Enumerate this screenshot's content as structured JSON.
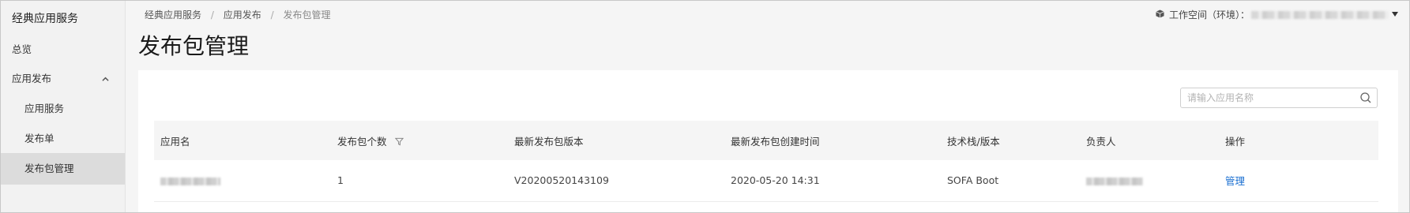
{
  "sidebar": {
    "title": "经典应用服务",
    "items": [
      {
        "label": "总览"
      },
      {
        "label": "应用发布",
        "expanded": true
      },
      {
        "label": "应用服务"
      },
      {
        "label": "发布单"
      },
      {
        "label": "发布包管理",
        "active": true
      }
    ]
  },
  "breadcrumb": [
    "经典应用服务",
    "应用发布",
    "发布包管理"
  ],
  "breadcrumb_sep": "/",
  "page": {
    "title": "发布包管理"
  },
  "workspace": {
    "label": "工作空间（环境）：",
    "icon": "cube-icon"
  },
  "search": {
    "placeholder": "请输入应用名称",
    "icon": "search-icon"
  },
  "table": {
    "columns": [
      "应用名",
      "发布包个数",
      "最新发布包版本",
      "最新发布包创建时间",
      "技术栈/版本",
      "负责人",
      "操作"
    ],
    "rows": [
      {
        "count": "1",
        "version": "V20200520143109",
        "created": "2020-05-20 14:31",
        "stack": "SOFA Boot",
        "action": "管理"
      }
    ]
  },
  "colors": {
    "link": "#1a6fd1",
    "sidebar_active": "#dcdcdc",
    "header_bg": "#f5f5f5"
  }
}
